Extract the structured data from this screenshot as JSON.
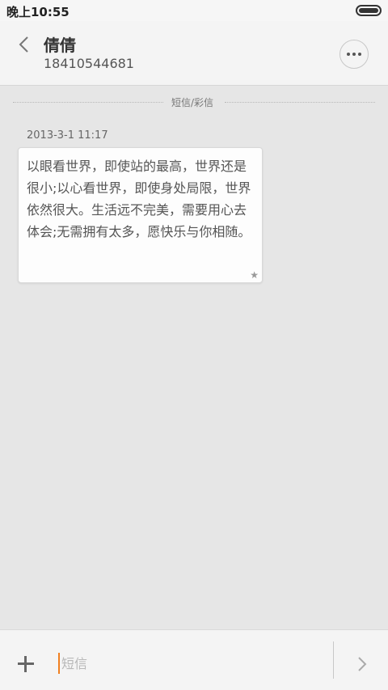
{
  "status_bar": {
    "time": "晚上10:55"
  },
  "header": {
    "contact_name": "倩倩",
    "contact_number": "18410544681"
  },
  "conversation": {
    "divider_label": "短信/彩信",
    "messages": [
      {
        "timestamp": "2013-3-1 11:17",
        "text": "以眼看世界，即使站的最高，世界还是很小;以心看世界，即使身处局限，世界依然很大。生活远不完美，需要用心去体会;无需拥有太多，愿快乐与你相随。",
        "starred": true
      }
    ]
  },
  "composer": {
    "placeholder": "短信"
  },
  "icons": {
    "back": "chevron-left-icon",
    "more": "more-dots-icon",
    "add": "plus-icon",
    "send": "chevron-right-icon",
    "star": "star-icon",
    "battery": "battery-icon"
  }
}
